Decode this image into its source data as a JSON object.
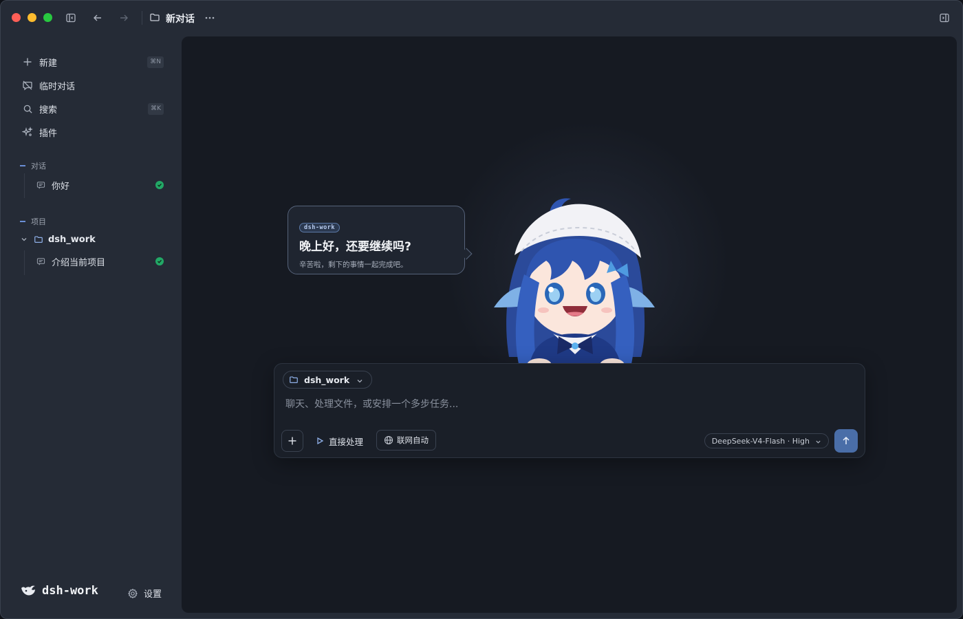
{
  "titlebar": {
    "title": "新对话",
    "more_icon": "ellipsis-icon"
  },
  "sidebar": {
    "nav": [
      {
        "label": "新建",
        "icon": "plus-icon",
        "shortcut": "⌘N"
      },
      {
        "label": "临时对话",
        "icon": "chat-off-icon",
        "shortcut": ""
      },
      {
        "label": "搜索",
        "icon": "search-icon",
        "shortcut": "⌘K"
      },
      {
        "label": "插件",
        "icon": "sparkles-icon",
        "shortcut": ""
      }
    ],
    "conversations_label": "对话",
    "conversations": [
      {
        "title": "你好",
        "status": "done"
      }
    ],
    "projects_label": "项目",
    "project": {
      "name": "dsh_work",
      "items": [
        {
          "title": "介绍当前项目",
          "status": "done"
        }
      ]
    },
    "brand": "dsh-work",
    "settings_label": "设置"
  },
  "main": {
    "bubble": {
      "tag": "dsh-work",
      "title": "晚上好，还要继续吗?",
      "subtitle": "辛苦啦，剩下的事情一起完成吧。"
    },
    "composer": {
      "project_chip": "dsh_work",
      "placeholder": "聊天、处理文件，或安排一个多步任务...",
      "direct_label": "直接处理",
      "web_label": "联网自动",
      "model_label": "DeepSeek-V4-Flash · High"
    }
  },
  "colors": {
    "accent": "#4a6ea8",
    "success": "#22a866",
    "sidebar_bg": "#252b36",
    "main_bg": "#161a22"
  }
}
